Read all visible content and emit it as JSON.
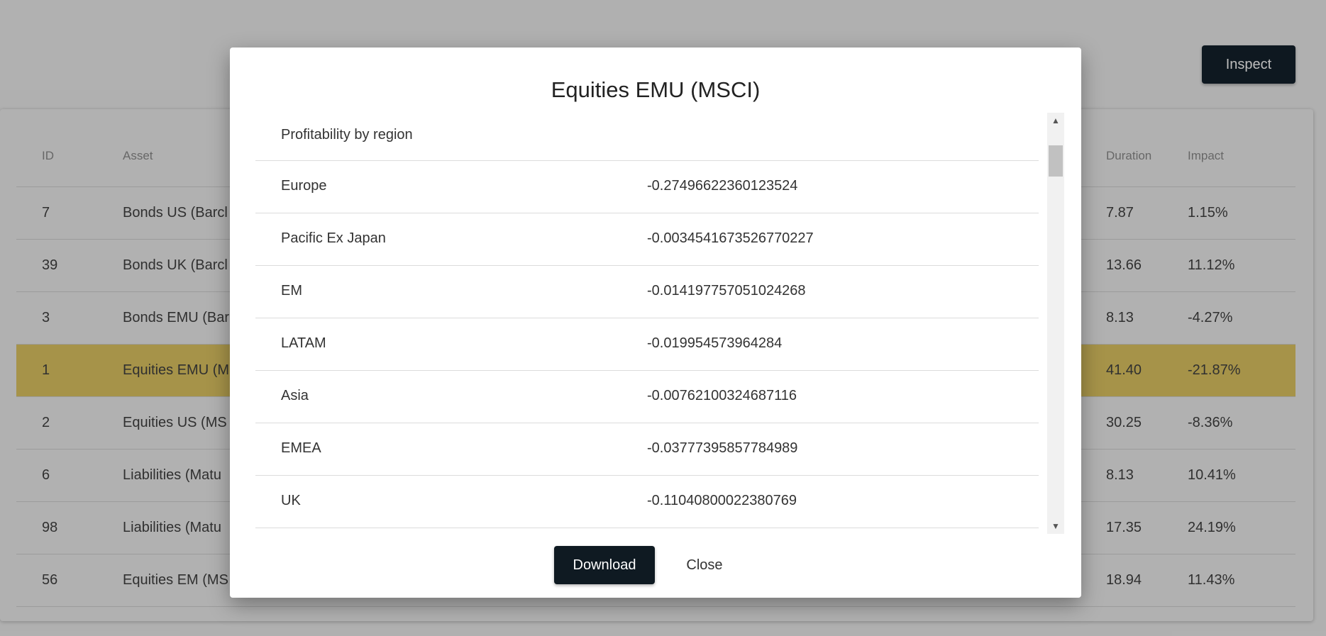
{
  "page": {
    "inspect_label": "Inspect",
    "table": {
      "headers": {
        "id": "ID",
        "asset": "Asset",
        "duration": "Duration",
        "impact": "Impact"
      },
      "rows": [
        {
          "id": "7",
          "asset": "Bonds US (Barcl",
          "duration": "7.87",
          "impact": "1.15%",
          "highlight": false
        },
        {
          "id": "39",
          "asset": "Bonds UK (Barcl",
          "duration": "13.66",
          "impact": "11.12%",
          "highlight": false
        },
        {
          "id": "3",
          "asset": "Bonds EMU (Bar",
          "duration": "8.13",
          "impact": "-4.27%",
          "highlight": false
        },
        {
          "id": "1",
          "asset": "Equities EMU (M",
          "duration": "41.40",
          "impact": "-21.87%",
          "highlight": true
        },
        {
          "id": "2",
          "asset": "Equities US (MS",
          "duration": "30.25",
          "impact": "-8.36%",
          "highlight": false
        },
        {
          "id": "6",
          "asset": "Liabilities (Matu",
          "duration": "8.13",
          "impact": "10.41%",
          "highlight": false
        },
        {
          "id": "98",
          "asset": "Liabilities (Matu",
          "duration": "17.35",
          "impact": "24.19%",
          "highlight": false
        },
        {
          "id": "56",
          "asset": "Equities EM (MS",
          "duration": "18.94",
          "impact": "11.43%",
          "highlight": false
        }
      ]
    }
  },
  "modal": {
    "title": "Equities EMU (MSCI)",
    "section_header": "Profitability by region",
    "rows": [
      {
        "label": "Europe",
        "value": "-0.27496622360123524"
      },
      {
        "label": "Pacific Ex Japan",
        "value": "-0.0034541673526770227"
      },
      {
        "label": "EM",
        "value": "-0.014197757051024268"
      },
      {
        "label": "LATAM",
        "value": "-0.019954573964284"
      },
      {
        "label": "Asia",
        "value": "-0.00762100324687116"
      },
      {
        "label": "EMEA",
        "value": "-0.03777395857784989"
      },
      {
        "label": "UK",
        "value": "-0.11040800022380769"
      }
    ],
    "download_label": "Download",
    "close_label": "Close"
  },
  "icons": {
    "scroll_up": "triangle-up-icon",
    "scroll_down": "triangle-down-icon"
  }
}
